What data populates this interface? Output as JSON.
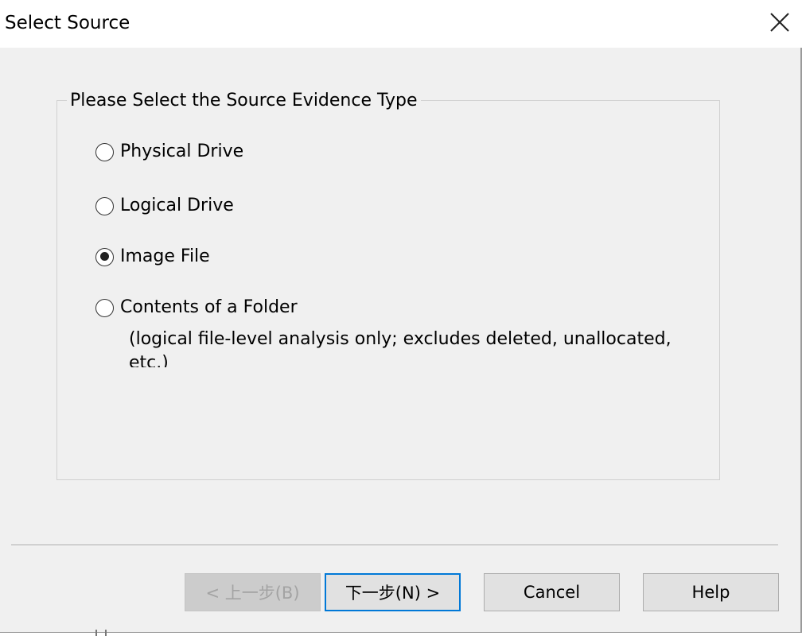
{
  "window": {
    "title": "Select Source"
  },
  "groupbox": {
    "legend": "Please Select the Source Evidence Type"
  },
  "options": [
    {
      "label": "Physical Drive",
      "checked": false
    },
    {
      "label": "Logical Drive",
      "checked": false
    },
    {
      "label": "Image File",
      "checked": true
    },
    {
      "label": "Contents of a Folder",
      "checked": false
    }
  ],
  "folder_note": "(logical file-level analysis only; excludes deleted, unallocated, etc.)",
  "buttons": {
    "back": "< 上一步(B)",
    "next": "下一步(N) >",
    "cancel": "Cancel",
    "help": "Help"
  },
  "icons": {
    "close": "close-icon"
  }
}
